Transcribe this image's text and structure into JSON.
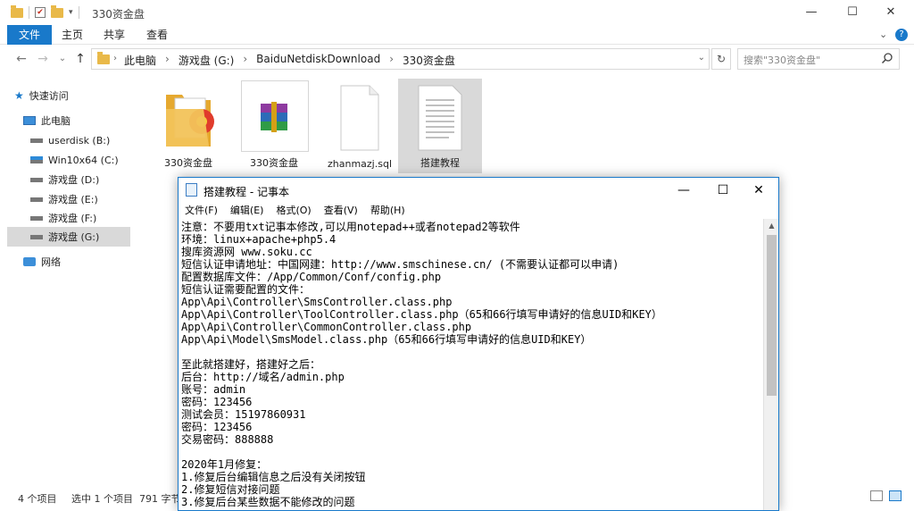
{
  "explorer": {
    "title": "330资金盘",
    "window_controls": {
      "minimize": "—",
      "maximize": "☐",
      "close": "✕"
    },
    "ribbon_tabs": [
      "文件",
      "主页",
      "共享",
      "查看"
    ],
    "ribbon_right": {
      "collapse": "⌄",
      "help": "?"
    },
    "nav": {
      "back": "←",
      "forward": "→",
      "recent": "⌄",
      "up": "↑"
    },
    "breadcrumbs": [
      "此电脑",
      "游戏盘 (G:)",
      "BaiduNetdiskDownload",
      "330资金盘"
    ],
    "refresh": "↻",
    "search_placeholder": "搜索\"330资金盘\"",
    "sidebar": [
      {
        "label": "快速访问",
        "icon": "star-icon"
      },
      {
        "label": "此电脑",
        "icon": "computer-icon"
      },
      {
        "label": "userdisk (B:)",
        "icon": "drive-icon"
      },
      {
        "label": "Win10x64 (C:)",
        "icon": "windows-drive-icon"
      },
      {
        "label": "游戏盘 (D:)",
        "icon": "drive-icon"
      },
      {
        "label": "游戏盘 (E:)",
        "icon": "drive-icon"
      },
      {
        "label": "游戏盘 (F:)",
        "icon": "drive-icon"
      },
      {
        "label": "游戏盘 (G:)",
        "icon": "drive-icon",
        "selected": true
      },
      {
        "label": "网络",
        "icon": "network-icon"
      }
    ],
    "files": [
      {
        "label": "330资金盘",
        "icon": "folder-icon"
      },
      {
        "label": "330资金盘",
        "icon": "winrar-archive-icon"
      },
      {
        "label": "zhanmazj.sql",
        "icon": "blank-file-icon"
      },
      {
        "label": "搭建教程",
        "icon": "text-file-icon",
        "selected": true
      }
    ],
    "status": {
      "count": "4 个项目",
      "selected": "选中 1 个项目",
      "size": "791 字节"
    }
  },
  "notepad": {
    "title": "搭建教程 - 记事本",
    "window_controls": {
      "minimize": "—",
      "maximize": "☐",
      "close": "✕"
    },
    "menu": [
      "文件(F)",
      "编辑(E)",
      "格式(O)",
      "查看(V)",
      "帮助(H)"
    ],
    "lines": [
      "注意：不要用txt记事本修改,可以用notepad++或者notepad2等软件",
      "环境：linux+apache+php5.4",
      "搜库资源网 www.soku.cc",
      "短信认证申请地址：中国网建：http://www.smschinese.cn/ (不需要认证都可以申请)",
      "配置数据库文件：/App/Common/Conf/config.php",
      "短信认证需要配置的文件：",
      "App\\Api\\Controller\\SmsController.class.php",
      "App\\Api\\Controller\\ToolController.class.php（65和66行填写申请好的信息UID和KEY）",
      "App\\Api\\Controller\\CommonController.class.php",
      "App\\Api\\Model\\SmsModel.class.php（65和66行填写申请好的信息UID和KEY）",
      "",
      "至此就搭建好，搭建好之后：",
      "后台：http://域名/admin.php",
      "账号：admin",
      "密码：123456",
      "测试会员：15197860931",
      "密码：123456",
      "交易密码：888888",
      "",
      "2020年1月修复：",
      "1.修复后台编辑信息之后没有关闭按钮",
      "2.修复短信对接问题",
      "3.修复后台某些数据不能修改的问题"
    ]
  }
}
